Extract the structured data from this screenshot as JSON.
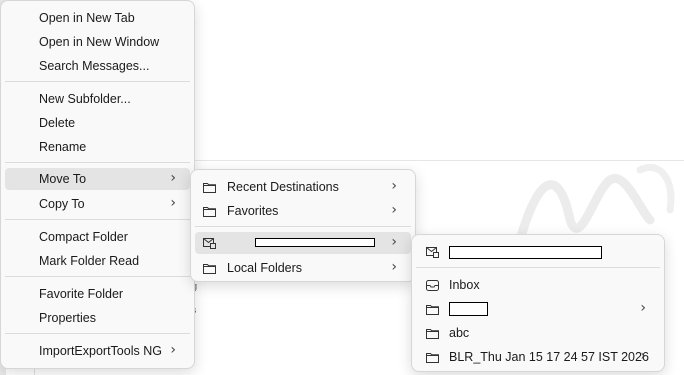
{
  "background": {
    "fragment_a": "g",
    "fragment_b": "'s"
  },
  "menu1": {
    "items": [
      {
        "label": "Open in New Tab"
      },
      {
        "label": "Open in New Window"
      },
      {
        "label": "Search Messages..."
      },
      {
        "label": "New Subfolder..."
      },
      {
        "label": "Delete"
      },
      {
        "label": "Rename"
      },
      {
        "label": "Move To",
        "submenu": true,
        "highlighted": true
      },
      {
        "label": "Copy To",
        "submenu": true
      },
      {
        "label": "Compact Folder"
      },
      {
        "label": "Mark Folder Read"
      },
      {
        "label": "Favorite Folder"
      },
      {
        "label": "Properties"
      },
      {
        "label": "ImportExportTools NG",
        "submenu": true
      }
    ]
  },
  "menu2": {
    "items": [
      {
        "label": "Recent Destinations",
        "icon": "folder-icon",
        "submenu": true
      },
      {
        "label": "Favorites",
        "icon": "folder-icon",
        "submenu": true
      },
      {
        "label": "",
        "icon": "mail-account-icon",
        "submenu": true,
        "highlighted": true,
        "redacted": true
      },
      {
        "label": "Local Folders",
        "icon": "folder-icon",
        "submenu": true
      }
    ]
  },
  "menu3": {
    "items": [
      {
        "label": "",
        "icon": "mail-account-icon",
        "redacted": true
      },
      {
        "label": "Inbox",
        "icon": "inbox-icon"
      },
      {
        "label": "",
        "icon": "folder-icon",
        "submenu": true,
        "redacted": true
      },
      {
        "label": "abc",
        "icon": "folder-icon"
      },
      {
        "label": "BLR_Thu Jan 15 17 24 57 IST 2026",
        "icon": "folder-icon",
        "submenu": true
      }
    ]
  },
  "arrow_glyph": "›"
}
